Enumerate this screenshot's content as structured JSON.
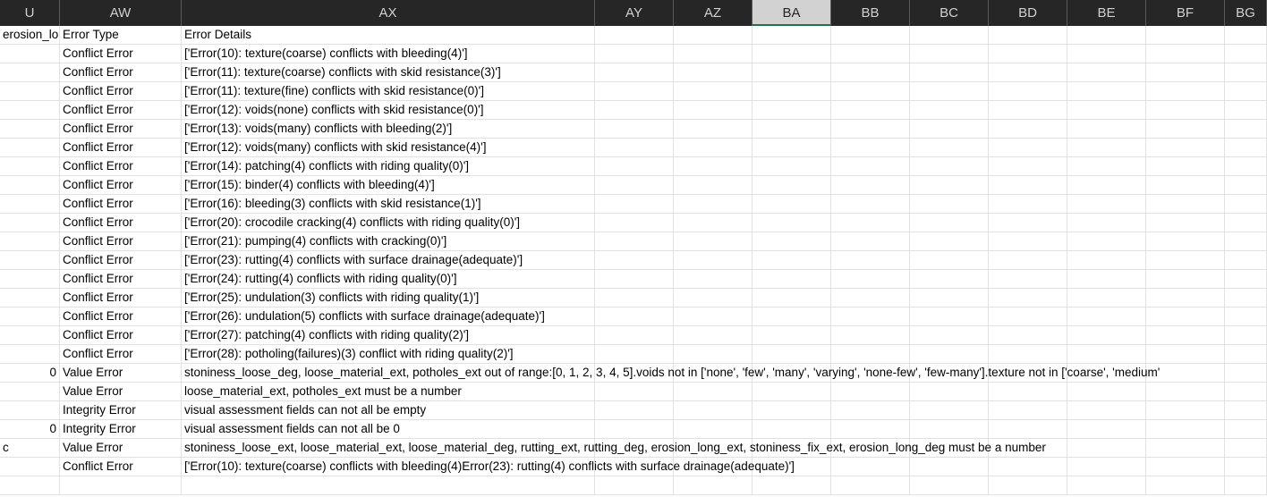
{
  "columns": [
    "U",
    "AW",
    "AX",
    "AY",
    "AZ",
    "BA",
    "BB",
    "BC",
    "BD",
    "BE",
    "BF",
    "BG"
  ],
  "selected_column": "BA",
  "colors": {
    "header_bg": "#262626",
    "selected_header": "#d2d2d2",
    "accent": "#217346",
    "grid": "#e1e1e1"
  },
  "rows": [
    {
      "u": "erosion_lo",
      "aw": "Error Type",
      "ax": "Error Details"
    },
    {
      "u": "",
      "aw": "Conflict Error",
      "ax": "['Error(10): texture(coarse) conflicts with bleeding(4)']"
    },
    {
      "u": "",
      "aw": "Conflict Error",
      "ax": "['Error(11): texture(coarse) conflicts with skid resistance(3)']"
    },
    {
      "u": "",
      "aw": "Conflict Error",
      "ax": "['Error(11): texture(fine) conflicts with skid resistance(0)']"
    },
    {
      "u": "",
      "aw": "Conflict Error",
      "ax": "['Error(12): voids(none) conflicts with skid resistance(0)']"
    },
    {
      "u": "",
      "aw": "Conflict Error",
      "ax": "['Error(13): voids(many) conflicts with bleeding(2)']"
    },
    {
      "u": "",
      "aw": "Conflict Error",
      "ax": "['Error(12): voids(many) conflicts with skid resistance(4)']"
    },
    {
      "u": "",
      "aw": "Conflict Error",
      "ax": "['Error(14): patching(4) conflicts with riding quality(0)']"
    },
    {
      "u": "",
      "aw": "Conflict Error",
      "ax": "['Error(15): binder(4) conflicts with bleeding(4)']"
    },
    {
      "u": "",
      "aw": "Conflict Error",
      "ax": "['Error(16): bleeding(3) conflicts with skid resistance(1)']"
    },
    {
      "u": "",
      "aw": "Conflict Error",
      "ax": "['Error(20): crocodile cracking(4) conflicts with riding quality(0)']"
    },
    {
      "u": "",
      "aw": "Conflict Error",
      "ax": "['Error(21): pumping(4) conflicts with cracking(0)']"
    },
    {
      "u": "",
      "aw": "Conflict Error",
      "ax": "['Error(23): rutting(4) conflicts with surface drainage(adequate)']"
    },
    {
      "u": "",
      "aw": "Conflict Error",
      "ax": "['Error(24): rutting(4) conflicts with riding quality(0)']"
    },
    {
      "u": "",
      "aw": "Conflict Error",
      "ax": "['Error(25): undulation(3) conflicts with riding quality(1)']"
    },
    {
      "u": "",
      "aw": "Conflict Error",
      "ax": "['Error(26): undulation(5) conflicts with surface drainage(adequate)']"
    },
    {
      "u": "",
      "aw": "Conflict Error",
      "ax": "['Error(27): patching(4) conflicts with riding quality(2)']"
    },
    {
      "u": "",
      "aw": "Conflict Error",
      "ax": "['Error(28): potholing(failures)(3) conflict with riding quality(2)']"
    },
    {
      "u": "0",
      "aw": "Value Error",
      "ax": "stoniness_loose_deg, loose_material_ext, potholes_ext out of range:[0, 1, 2, 3, 4, 5].voids not in ['none', 'few', 'many', 'varying', 'none-few', 'few-many'].texture not in ['coarse', 'medium'"
    },
    {
      "u": "",
      "aw": "Value Error",
      "ax": " loose_material_ext, potholes_ext must be a number"
    },
    {
      "u": "",
      "aw": "Integrity Error",
      "ax": "visual assessment fields can not all be empty"
    },
    {
      "u": "0",
      "aw": "Integrity Error",
      "ax": "visual assessment fields can not all be 0"
    },
    {
      "u": "c",
      "aw": "Value Error",
      "ax": " stoniness_loose_ext, loose_material_ext, loose_material_deg, rutting_ext, rutting_deg, erosion_long_ext, stoniness_fix_ext, erosion_long_deg must be a number"
    },
    {
      "u": "",
      "aw": "Conflict Error",
      "ax": "['Error(10): texture(coarse) conflicts with bleeding(4)Error(23): rutting(4) conflicts with surface drainage(adequate)']"
    },
    {
      "u": "",
      "aw": "",
      "ax": ""
    }
  ]
}
